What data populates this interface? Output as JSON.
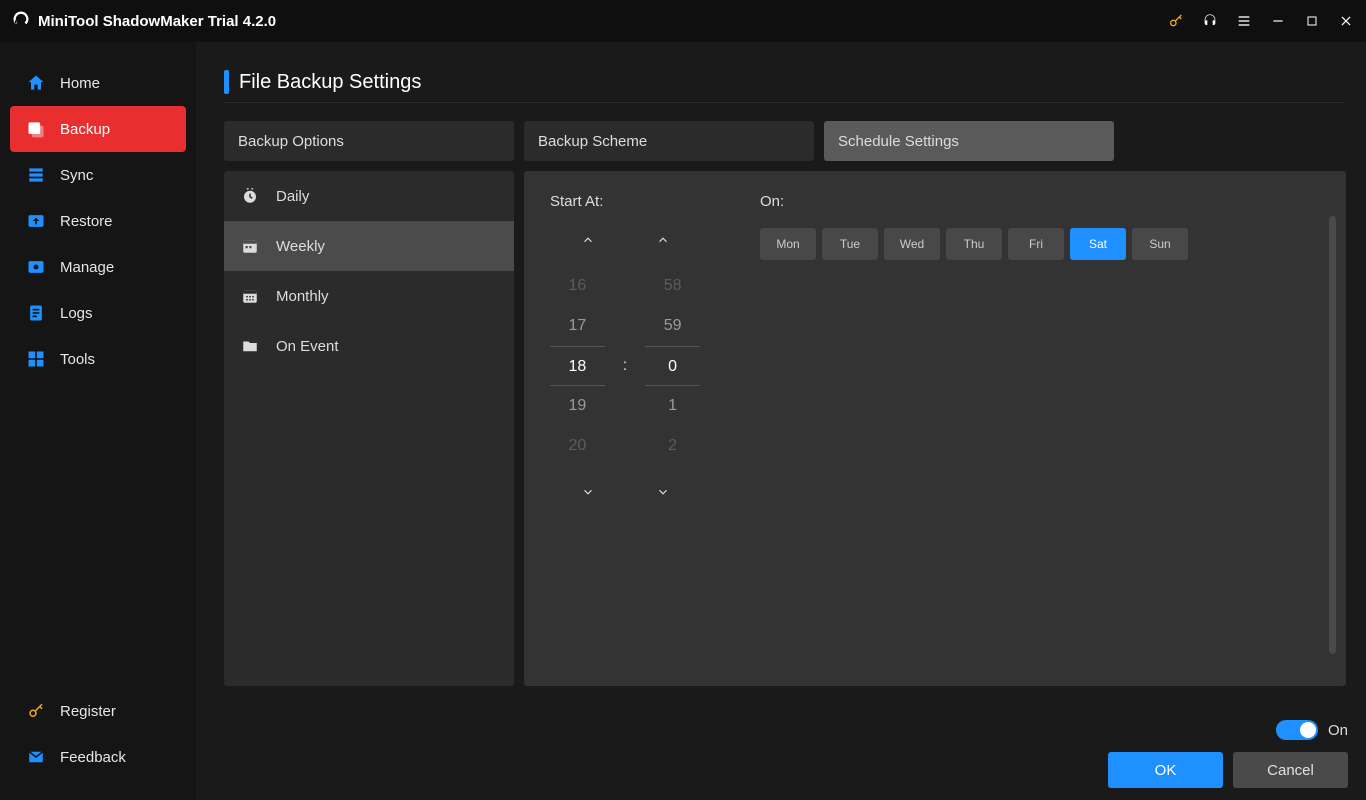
{
  "app": {
    "title": "MiniTool ShadowMaker Trial 4.2.0"
  },
  "sidebar": {
    "items": [
      {
        "label": "Home"
      },
      {
        "label": "Backup"
      },
      {
        "label": "Sync"
      },
      {
        "label": "Restore"
      },
      {
        "label": "Manage"
      },
      {
        "label": "Logs"
      },
      {
        "label": "Tools"
      }
    ],
    "bottom": {
      "register": "Register",
      "feedback": "Feedback"
    }
  },
  "page": {
    "title": "File Backup Settings"
  },
  "tabs": [
    {
      "label": "Backup Options"
    },
    {
      "label": "Backup Scheme"
    },
    {
      "label": "Schedule Settings"
    }
  ],
  "schedule": {
    "modes": [
      {
        "label": "Daily"
      },
      {
        "label": "Weekly"
      },
      {
        "label": "Monthly"
      },
      {
        "label": "On Event"
      }
    ],
    "start_at_label": "Start At:",
    "on_label": "On:",
    "hours": [
      "16",
      "17",
      "18",
      "19",
      "20"
    ],
    "minutes": [
      "58",
      "59",
      "0",
      "1",
      "2"
    ],
    "days": [
      "Mon",
      "Tue",
      "Wed",
      "Thu",
      "Fri",
      "Sat",
      "Sun"
    ],
    "selected_day_index": 5
  },
  "footer": {
    "toggle_label": "On",
    "ok": "OK",
    "cancel": "Cancel"
  }
}
